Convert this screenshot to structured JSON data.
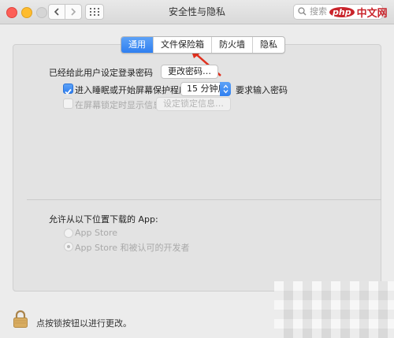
{
  "window": {
    "title": "安全性与隐私"
  },
  "search": {
    "placeholder": "搜索"
  },
  "watermark": {
    "logo": "php",
    "text": "中文网"
  },
  "tabs": [
    {
      "label": "通用",
      "active": true
    },
    {
      "label": "文件保险箱",
      "active": false
    },
    {
      "label": "防火墙",
      "active": false
    },
    {
      "label": "隐私",
      "active": false
    }
  ],
  "general": {
    "password_label": "已经给此用户设定登录密码",
    "change_password_button": "更改密码…",
    "require_password_label": "进入睡眠或开始屏幕保护程序",
    "require_password_checked": true,
    "delay_value": "15 分钟后",
    "require_password_suffix": "要求输入密码",
    "lock_message_label": "在屏幕锁定时显示信息",
    "lock_message_checked": false,
    "set_lock_message_button": "设定锁定信息…"
  },
  "downloads": {
    "heading": "允许从以下位置下载的 App:",
    "options": [
      {
        "label": "App Store",
        "selected": false
      },
      {
        "label": "App Store 和被认可的开发者",
        "selected": true
      }
    ]
  },
  "footer": {
    "lock_text": "点按锁按钮以进行更改。"
  },
  "colors": {
    "accent": "#2f7ff0",
    "annotation_arrow": "#e0301e"
  }
}
